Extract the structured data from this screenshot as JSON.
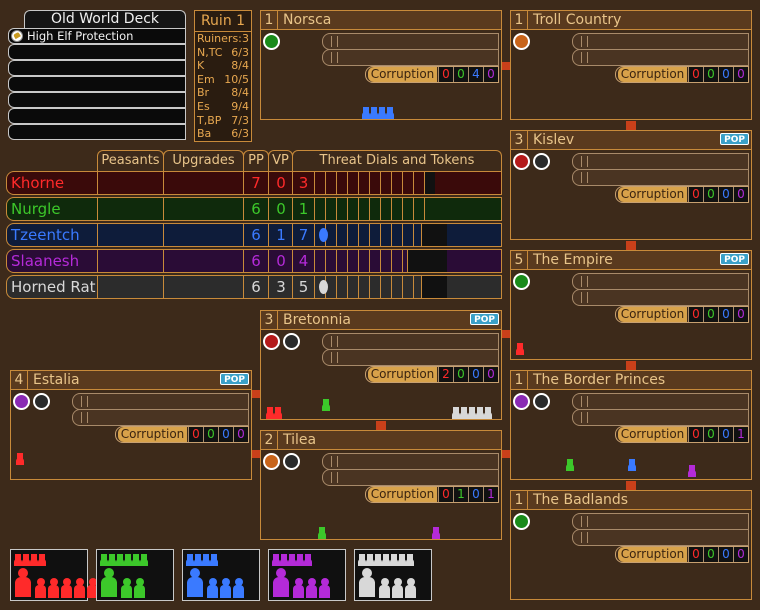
{
  "deck": {
    "title": "Old World Deck",
    "cards": [
      "High Elf Protection",
      "",
      "",
      "",
      "",
      "",
      ""
    ]
  },
  "ruin": {
    "title": "Ruin 1",
    "lines": [
      {
        "name": "Ruiners:",
        "value": "3"
      },
      {
        "name": "N,TC",
        "value": "6/3"
      },
      {
        "name": "K",
        "value": "8/4"
      },
      {
        "name": "Em",
        "value": "10/5"
      },
      {
        "name": "Br",
        "value": "8/4"
      },
      {
        "name": "Es",
        "value": "9/4"
      },
      {
        "name": "T,BP",
        "value": "7/3"
      },
      {
        "name": "Ba",
        "value": "6/3"
      }
    ]
  },
  "players_table": {
    "headers": {
      "peasants": "Peasants",
      "upgrades": "Upgrades",
      "pp": "PP",
      "vp": "VP",
      "threat": "Threat Dials and Tokens"
    },
    "rows": [
      {
        "name": "Khorne",
        "pp": "7",
        "vp": "0",
        "threat": "3",
        "color": "#ff2a2a",
        "bg": "#3a0a0a"
      },
      {
        "name": "Nurgle",
        "pp": "6",
        "vp": "0",
        "threat": "1",
        "color": "#3cc82a",
        "bg": "#0f2a0c"
      },
      {
        "name": "Tzeentch",
        "pp": "6",
        "vp": "1",
        "threat": "7",
        "color": "#3a7aff",
        "bg": "#0e1c3a"
      },
      {
        "name": "Slaanesh",
        "pp": "6",
        "vp": "0",
        "threat": "4",
        "color": "#b42ad8",
        "bg": "#2a0c36"
      },
      {
        "name": "Horned Rat",
        "pp": "6",
        "vp": "3",
        "threat": "5",
        "color": "#d8d8d8",
        "bg": "#2c2c2c"
      }
    ]
  },
  "regions": {
    "norsca": {
      "num": "1",
      "name": "Norsca",
      "pop": "",
      "corruption_label": "Corruption",
      "corruption": [
        "0",
        "0",
        "4",
        "0"
      ]
    },
    "troll_country": {
      "num": "1",
      "name": "Troll Country",
      "pop": "",
      "corruption_label": "Corruption",
      "corruption": [
        "0",
        "0",
        "0",
        "0"
      ]
    },
    "kislev": {
      "num": "3",
      "name": "Kislev",
      "pop": "POP",
      "corruption_label": "Corruption",
      "corruption": [
        "0",
        "0",
        "0",
        "0"
      ]
    },
    "the_empire": {
      "num": "5",
      "name": "The Empire",
      "pop": "POP",
      "corruption_label": "Corruption",
      "corruption": [
        "0",
        "0",
        "0",
        "0"
      ]
    },
    "bretonnia": {
      "num": "3",
      "name": "Bretonnia",
      "pop": "POP",
      "corruption_label": "Corruption",
      "corruption": [
        "2",
        "0",
        "0",
        "0"
      ]
    },
    "the_border_princes": {
      "num": "1",
      "name": "The Border Princes",
      "pop": "",
      "corruption_label": "Corruption",
      "corruption": [
        "0",
        "0",
        "0",
        "1"
      ]
    },
    "estalia": {
      "num": "4",
      "name": "Estalia",
      "pop": "POP",
      "corruption_label": "Corruption",
      "corruption": [
        "0",
        "0",
        "0",
        "0"
      ]
    },
    "tilea": {
      "num": "2",
      "name": "Tilea",
      "pop": "",
      "corruption_label": "Corruption",
      "corruption": [
        "0",
        "1",
        "0",
        "1"
      ]
    },
    "the_badlands": {
      "num": "1",
      "name": "The Badlands",
      "pop": "",
      "corruption_label": "Corruption",
      "corruption": [
        "0",
        "0",
        "0",
        "0"
      ]
    }
  },
  "colors": {
    "khorne": "#ff2a2a",
    "nurgle": "#3cc82a",
    "tzeentch": "#3a7aff",
    "slaanesh": "#b42ad8",
    "horned_rat": "#d8d8d8",
    "border": "#c88a3a",
    "background": "#3d2a1a"
  }
}
